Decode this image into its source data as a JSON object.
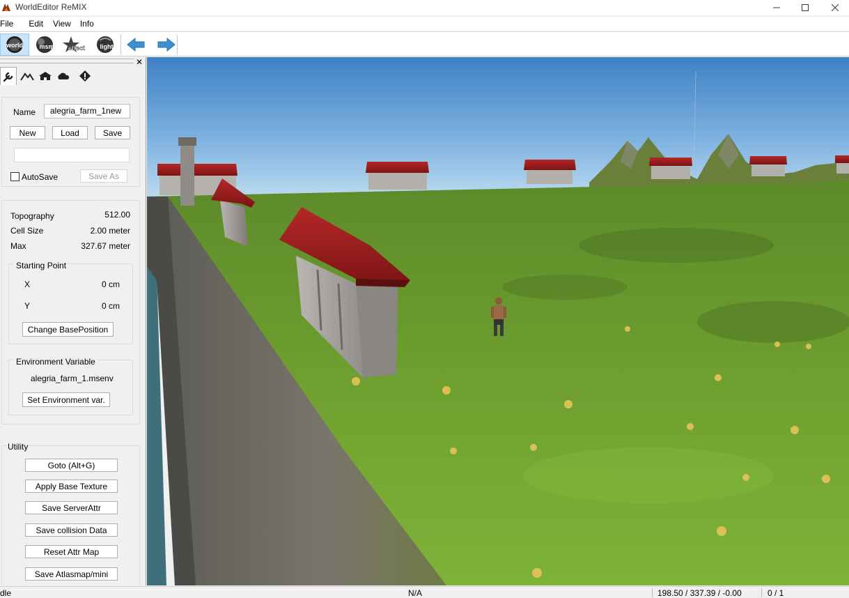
{
  "window": {
    "title": "WorldEditor ReMIX"
  },
  "menu": [
    "File",
    "Edit",
    "View",
    "Info"
  ],
  "toolbar": {
    "buttons": [
      {
        "label": "world",
        "icon": "world-icon"
      },
      {
        "label": "msm",
        "icon": "msm-icon"
      },
      {
        "label": "effect",
        "icon": "effect-icon"
      },
      {
        "label": "light",
        "icon": "light-icon"
      }
    ]
  },
  "panel": {
    "name_label": "Name",
    "name_value": "alegria_farm_1new",
    "new_label": "New",
    "load_label": "Load",
    "save_label": "Save",
    "autosave_label": "AutoSave",
    "save_as_label": "Save As",
    "topography_label": "Topography",
    "topography_value": "512.00",
    "cellsize_label": "Cell Size",
    "cellsize_value": "2.00 meter",
    "max_label": "Max",
    "max_value": "327.67 meter",
    "starting_point_title": "Starting Point",
    "x_label": "X",
    "x_value": "0 cm",
    "y_label": "Y",
    "y_value": "0 cm",
    "change_base_label": "Change BasePosition",
    "env_title": "Environment Variable",
    "env_value": "alegria_farm_1.msenv",
    "set_env_label": "Set Environment var.",
    "utility_title": "Utility",
    "utility_buttons": [
      "Goto (Alt+G)",
      "Apply Base Texture",
      "Save ServerAttr",
      "Save collision Data",
      "Reset Attr Map",
      "Save Atlasmap/mini"
    ]
  },
  "status": {
    "left": "dle",
    "center": "N/A",
    "coords": "198.50 / 337.39 / -0.00",
    "count": "0 / 1"
  },
  "colors": {
    "sky_top": "#3e7fc4",
    "sky_bottom": "#b8d8ee",
    "grass": "#6f9e2a",
    "roof": "#9b1c1c",
    "water": "#3f6f7a"
  }
}
